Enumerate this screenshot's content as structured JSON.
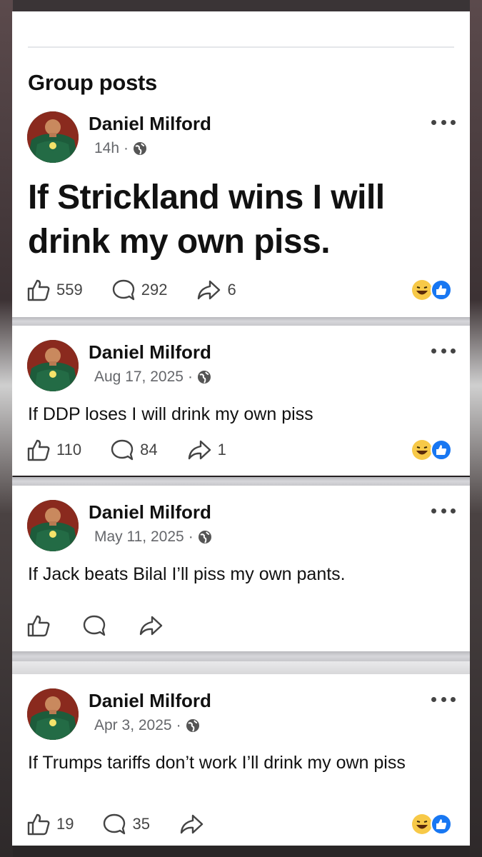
{
  "section": {
    "title": "Group posts"
  },
  "posts": [
    {
      "author": "Daniel Milford",
      "time": "14h",
      "separator": "·",
      "text": "If Strickland wins I will drink my own piss.",
      "likes": "559",
      "comments": "292",
      "shares": "6",
      "reactions": [
        "haha",
        "like"
      ]
    },
    {
      "author": "Daniel Milford",
      "time": "Aug 17, 2025",
      "separator": "·",
      "text": "If DDP loses I will drink my own piss",
      "likes": "110",
      "comments": "84",
      "shares": "1",
      "reactions": [
        "haha",
        "like"
      ]
    },
    {
      "author": "Daniel Milford",
      "time": "May 11, 2025",
      "separator": "·",
      "text": "If Jack beats Bilal I’ll piss my own pants.",
      "likes": "",
      "comments": "",
      "shares": "",
      "reactions": []
    },
    {
      "author": "Daniel Milford",
      "time": "Apr 3, 2025",
      "separator": "·",
      "text": "If Trumps tariffs don’t work I’ll drink my own piss",
      "likes": "19",
      "comments": "35",
      "shares": "",
      "reactions": [
        "haha",
        "like"
      ]
    }
  ],
  "icons": {
    "like": "thumbs-up-outline-icon",
    "comment": "comment-bubble-icon",
    "share": "share-arrow-icon",
    "privacy": "globe-icon",
    "more": "more-dots-icon"
  },
  "colors": {
    "like_blue": "#1877f2",
    "haha_yellow": "#f7c948",
    "meta_gray": "#65676b"
  }
}
